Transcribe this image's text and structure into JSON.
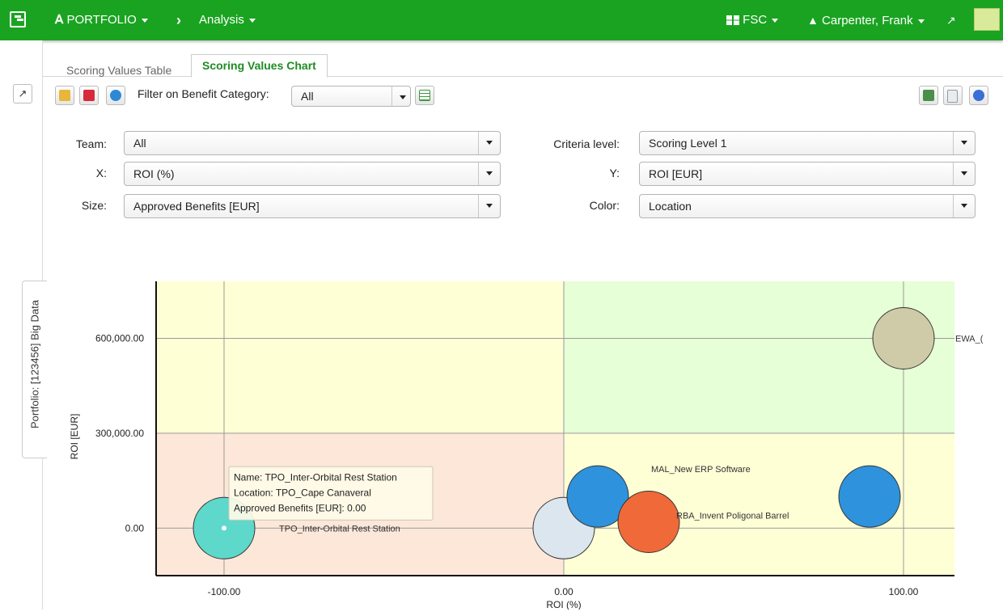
{
  "header": {
    "portfolio_label": "PORTFOLIO",
    "analysis_label": "Analysis",
    "org_label": "FSC",
    "user_label": "Carpenter, Frank"
  },
  "tabs": [
    {
      "label": "Scoring Values Table",
      "active": false
    },
    {
      "label": "Scoring Values Chart",
      "active": true
    }
  ],
  "side_tab": {
    "label": "Portfolio: [123456] Big Data"
  },
  "toolbar": {
    "filter_label": "Filter on Benefit Category:",
    "filter_value": "All"
  },
  "form": {
    "team_label": "Team:",
    "team_value": "All",
    "x_label": "X:",
    "x_value": "ROI (%)",
    "size_label": "Size:",
    "size_value": "Approved Benefits [EUR]",
    "criteria_label": "Criteria level:",
    "criteria_value": "Scoring Level 1",
    "y_label": "Y:",
    "y_value": "ROI [EUR]",
    "color_label": "Color:",
    "color_value": "Location"
  },
  "tooltip": {
    "line1": "Name: TPO_Inter-Orbital Rest Station",
    "line2": "Location: TPO_Cape Canaveral",
    "line3": "Approved Benefits [EUR]: 0.00"
  },
  "chart_data": {
    "type": "scatter",
    "xlabel": "ROI (%)",
    "ylabel": "ROI [EUR]",
    "xlim": [
      -120,
      115
    ],
    "ylim": [
      -150000,
      780000
    ],
    "xticks": [
      -100,
      0,
      100
    ],
    "xtick_labels": [
      "-100.00",
      "0.00",
      "100.00"
    ],
    "yticks": [
      0,
      300000,
      600000
    ],
    "ytick_labels": [
      "0.00",
      "300,000.00",
      "600,000.00"
    ],
    "grid": true,
    "quadrant_colors": {
      "top_left": "#ffffd6",
      "top_right": "#e6ffd6",
      "bottom_left": "#fde7d8",
      "bottom_right": "#ffffd6"
    },
    "points": [
      {
        "name": "TPO_Inter-Orbital Rest Station",
        "label": "TPO_Inter-Orbital Rest Station",
        "x": -100,
        "y": 0,
        "color": "#5fd8cc"
      },
      {
        "name": "",
        "label": "",
        "x": 0,
        "y": 0,
        "color": "#dbe6ee"
      },
      {
        "name": "MAL_New ERP Software",
        "label": "MAL_New ERP Software",
        "x": 10,
        "y": 100000,
        "color": "#2e92dc"
      },
      {
        "name": "RBA_Invent Poligonal Barrel",
        "label": "RBA_Invent Poligonal Barrel",
        "x": 25,
        "y": 20000,
        "color": "#ef6a38"
      },
      {
        "name": "",
        "label": "",
        "x": 90,
        "y": 100000,
        "color": "#2e92dc"
      },
      {
        "name": "EWA_",
        "label": "EWA_(",
        "x": 100,
        "y": 600000,
        "color": "#cfcaa8"
      }
    ]
  }
}
